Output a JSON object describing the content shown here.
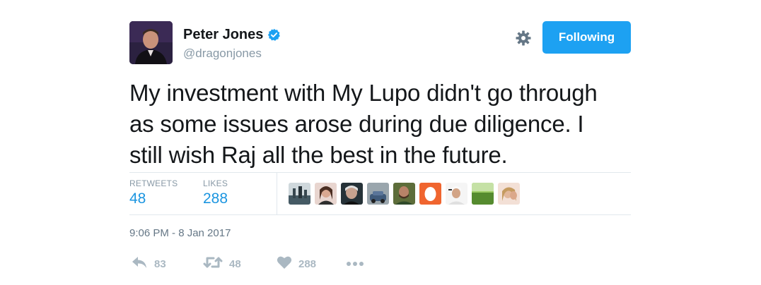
{
  "user": {
    "display_name": "Peter Jones",
    "handle": "@dragonjones",
    "verified": true
  },
  "follow_button": {
    "label": "Following"
  },
  "tweet": {
    "text_lines": [
      "My investment with My Lupo didn't go through",
      "as some issues arose during due diligence. I",
      "still wish Raj all the best in the future."
    ],
    "timestamp": "9:06 PM - 8 Jan 2017"
  },
  "stats": {
    "retweets_label": "RETWEETS",
    "retweets_value": "48",
    "likes_label": "LIKES",
    "likes_value": "288"
  },
  "actions": {
    "reply_count": "83",
    "retweet_count": "48",
    "like_count": "288"
  },
  "colors": {
    "accent": "#1da1f2",
    "stat_value": "#1b95e0",
    "muted": "#8899a6",
    "action_icon": "#aab8c2"
  },
  "icons": {
    "verified": "verified-badge-icon",
    "settings": "gear-icon",
    "reply": "reply-icon",
    "retweet": "retweet-icon",
    "like": "heart-icon",
    "more": "more-dots-icon"
  }
}
